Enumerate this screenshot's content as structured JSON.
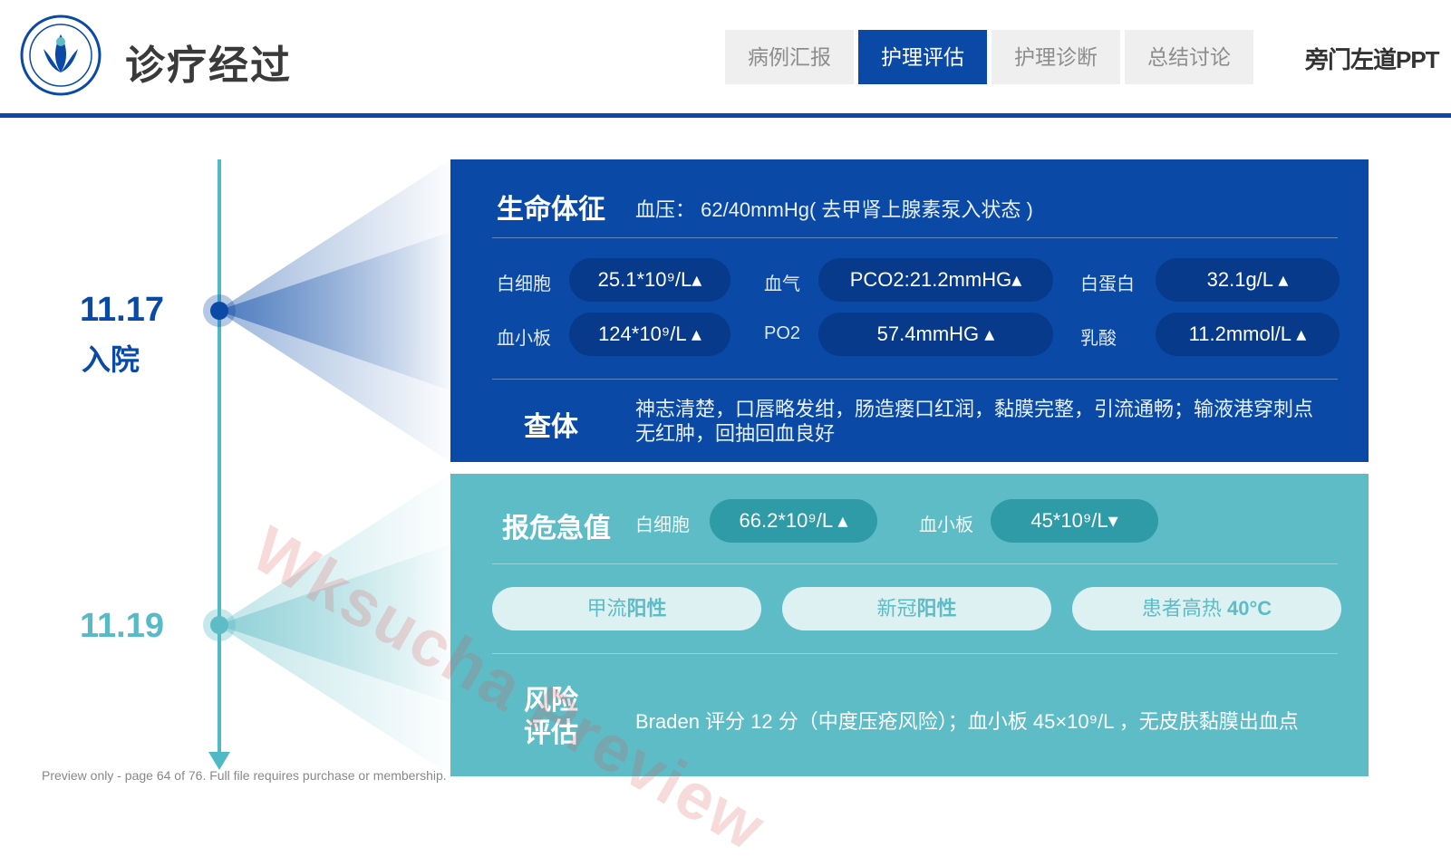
{
  "header": {
    "title": "诊疗经过",
    "brand": "旁门左道PPT",
    "tabs": [
      {
        "label": "病例汇报",
        "active": false
      },
      {
        "label": "护理评估",
        "active": true
      },
      {
        "label": "护理诊断",
        "active": false
      },
      {
        "label": "总结讨论",
        "active": false
      }
    ]
  },
  "timeline": {
    "entries": [
      {
        "date": "11.17",
        "sub": "入院"
      },
      {
        "date": "11.19",
        "sub": ""
      }
    ]
  },
  "vitals": {
    "heading": "生命体征",
    "bp": "血压： 62/40mmHg( 去甲肾上腺素泵入状态 )",
    "labs": [
      {
        "label": "白细胞",
        "value": "25.1*10⁹/L▴"
      },
      {
        "label": "血气",
        "value": "PCO2:21.2mmHG▴"
      },
      {
        "label": "白蛋白",
        "value": "32.1g/L ▴"
      },
      {
        "label": "血小板",
        "value": "124*10⁹/L ▴"
      },
      {
        "label": "PO2",
        "value": "57.4mmHG ▴"
      },
      {
        "label": "乳酸",
        "value": "11.2mmol/L ▴"
      }
    ],
    "exam_heading": "查体",
    "exam_text": "神志清楚，口唇略发绀，肠造瘘口红润，黏膜完整，引流通畅；输液港穿刺点无红肿，回抽回血良好"
  },
  "critical": {
    "heading": "报危急值",
    "items": [
      {
        "label": "白细胞",
        "value": "66.2*10⁹/L ▴"
      },
      {
        "label": "血小板",
        "value": "45*10⁹/L▾"
      }
    ],
    "tags": [
      {
        "prefix": "甲流",
        "strong": "阳性"
      },
      {
        "prefix": "新冠",
        "strong": "阳性"
      },
      {
        "prefix": "患者高热 ",
        "strong": "40°C"
      }
    ],
    "risk_heading_1": "风险",
    "risk_heading_2": "评估",
    "risk_text": "Braden 评分 12 分（中度压疮风险）；血小板 45×10⁹/L ，无皮肤黏膜出血点"
  },
  "overlay": {
    "watermark": "Wksucha Preview",
    "footer": "Preview only - page 64 of 76. Full file requires purchase or membership."
  },
  "colors": {
    "primary_blue": "#0a4aa6",
    "teal": "#5dbcc6",
    "pill_dark": "#073a8a",
    "pill_teal": "#2e9ba7"
  }
}
